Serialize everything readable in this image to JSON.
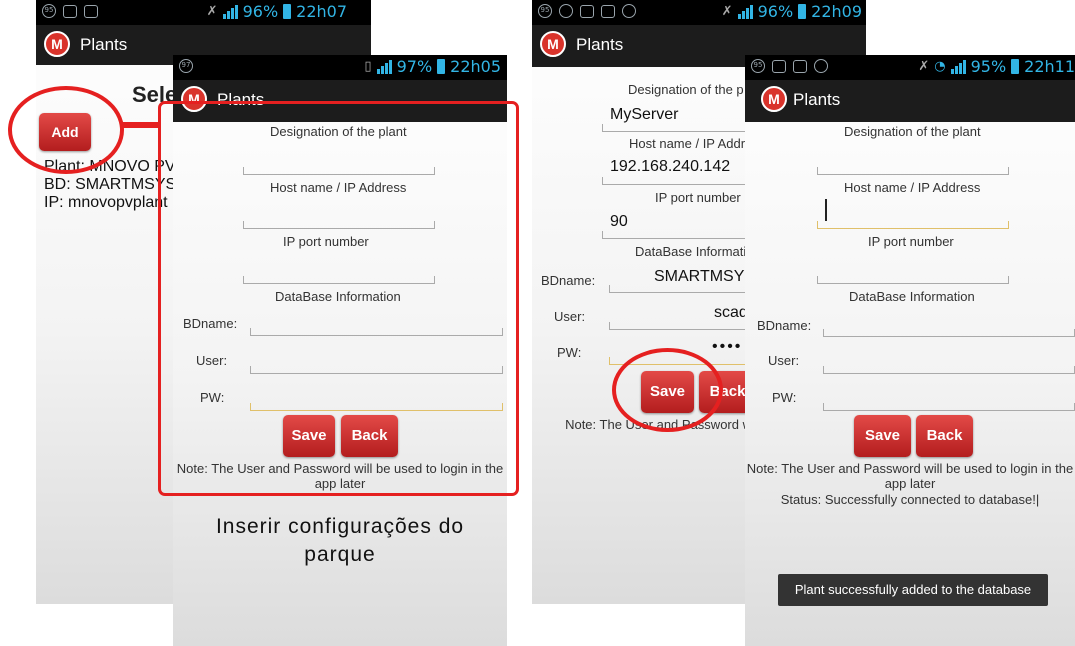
{
  "app_title": "Plants",
  "logo_letter": "M",
  "screen1": {
    "status_time": "22h07",
    "status_battery": "96%",
    "heading": "Sele",
    "add_label": "Add",
    "plant_lines": [
      "Plant: MNOVO PV",
      "BD: SMARTMSYS",
      "IP: mnovopvplant"
    ]
  },
  "screen2": {
    "status_time": "22h05",
    "status_battery": "97%",
    "form": {
      "designation": "Designation of the plant",
      "host": "Host name / IP Address",
      "port": "IP port number",
      "db_info": "DataBase Information",
      "bdname": "BDname:",
      "user": "User:",
      "pw": "PW:"
    },
    "save_label": "Save",
    "back_label": "Back",
    "note": "Note: The User and Password will be used to login in the app later",
    "caption": "Inserir configurações do parque"
  },
  "screen3": {
    "status_time": "22h09",
    "status_battery": "96%",
    "form": {
      "designation": "Designation of the p",
      "name_value": "MyServer",
      "host": "Host name / IP Addr",
      "host_value": "192.168.240.142",
      "port": "IP port number",
      "port_value": "90",
      "db_info": "DataBase Informati",
      "bdname": "BDname:",
      "bdname_value": "SMARTMSY",
      "user": "User:",
      "user_value": "scad",
      "pw": "PW:",
      "pw_value": "••••"
    },
    "save_label": "Save",
    "back_label": "Back",
    "note": "Note: The User and Password will be app later"
  },
  "screen4": {
    "status_time": "22h11",
    "status_battery": "95%",
    "form": {
      "designation": "Designation of the plant",
      "host": "Host name / IP Address",
      "port": "IP port number",
      "db_info": "DataBase Information",
      "bdname": "BDname:",
      "user": "User:",
      "pw": "PW:"
    },
    "save_label": "Save",
    "back_label": "Back",
    "note": "Note: The User and Password will be used to login in the app later",
    "status": "Status: Successfully connected to database!|",
    "toast": "Plant successfully added to the database"
  },
  "colors": {
    "accent": "#32b5e5",
    "button": "#c62a2a",
    "highlight": "#e52020"
  }
}
